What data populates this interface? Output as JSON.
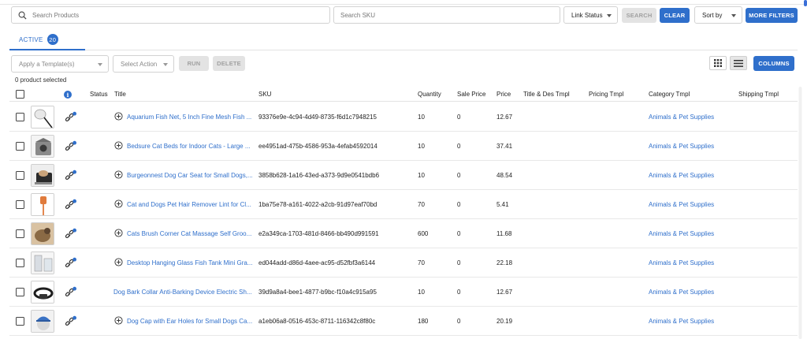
{
  "filters": {
    "search_products_placeholder": "Search Products",
    "search_sku_placeholder": "Search SKU",
    "link_status_label": "Link Status",
    "search_label": "SEARCH",
    "clear_label": "CLEAR",
    "sort_by_label": "Sort by",
    "more_filters_label": "MORE FILTERS"
  },
  "tabs": [
    {
      "label": "ACTIVE",
      "count": "20"
    }
  ],
  "bulk": {
    "template_placeholder": "Apply a Template(s)",
    "action_placeholder": "Select Action",
    "run_label": "RUN",
    "delete_label": "DELETE",
    "columns_label": "COLUMNS",
    "selected_text": "0 product selected"
  },
  "table": {
    "headers": {
      "info": "i",
      "status": "Status",
      "title": "Title",
      "sku": "SKU",
      "quantity": "Quantity",
      "sale_price": "Sale Price",
      "price": "Price",
      "title_des_tmpl": "Title & Des Tmpl",
      "pricing_tmpl": "Pricing Tmpl",
      "category_tmpl": "Category Tmpl",
      "shipping_tmpl": "Shipping Tmpl"
    },
    "rows": [
      {
        "title": "Aquarium Fish Net, 5 Inch Fine Mesh Fish ...",
        "sku": "93376e9e-4c94-4d49-8735-f6d1c7948215",
        "quantity": "10",
        "sale_price": "0",
        "price": "12.67",
        "category": "Animals & Pet Supplies",
        "has_expand": true,
        "thumb": "fish-net"
      },
      {
        "title": "Bedsure Cat Beds for Indoor Cats - Large ...",
        "sku": "ee4951ad-475b-4586-953a-4efab4592014",
        "quantity": "10",
        "sale_price": "0",
        "price": "37.41",
        "category": "Animals & Pet Supplies",
        "has_expand": true,
        "thumb": "cat-bed"
      },
      {
        "title": "Burgeonnest Dog Car Seat for Small Dogs,...",
        "sku": "3858b628-1a16-43ed-a373-9d9e0541bdb6",
        "quantity": "10",
        "sale_price": "0",
        "price": "48.54",
        "category": "Animals & Pet Supplies",
        "has_expand": true,
        "thumb": "car-seat"
      },
      {
        "title": "Cat and Dogs Pet Hair Remover Lint for Cl...",
        "sku": "1ba75e78-a161-4022-a2cb-91d97eaf70bd",
        "quantity": "70",
        "sale_price": "0",
        "price": "5.41",
        "category": "Animals & Pet Supplies",
        "has_expand": true,
        "thumb": "lint-roller"
      },
      {
        "title": "Cats Brush Corner Cat Massage Self Groo...",
        "sku": "e2a349ca-1703-481d-8466-bb490d991591",
        "quantity": "600",
        "sale_price": "0",
        "price": "11.68",
        "category": "Animals & Pet Supplies",
        "has_expand": true,
        "thumb": "cat-brush"
      },
      {
        "title": "Desktop Hanging Glass Fish Tank Mini Gra...",
        "sku": "ed044add-d86d-4aee-ac95-d52fbf3a6144",
        "quantity": "70",
        "sale_price": "0",
        "price": "22.18",
        "category": "Animals & Pet Supplies",
        "has_expand": true,
        "thumb": "fish-tank"
      },
      {
        "title": "Dog Bark Collar Anti-Barking Device Electric Sh...",
        "sku": "39d9a8a4-bee1-4877-b9bc-f10a4c915a95",
        "quantity": "10",
        "sale_price": "0",
        "price": "12.67",
        "category": "Animals & Pet Supplies",
        "has_expand": false,
        "thumb": "bark-collar"
      },
      {
        "title": "Dog Cap with Ear Holes for Small Dogs Ca...",
        "sku": "a1eb06a8-0516-453c-8711-116342c8f80c",
        "quantity": "180",
        "sale_price": "0",
        "price": "20.19",
        "category": "Animals & Pet Supplies",
        "has_expand": true,
        "thumb": "dog-cap"
      }
    ]
  },
  "colors": {
    "primary": "#2f6fcb",
    "disabled": "#e3e3e3",
    "border": "#d2d2d2"
  }
}
